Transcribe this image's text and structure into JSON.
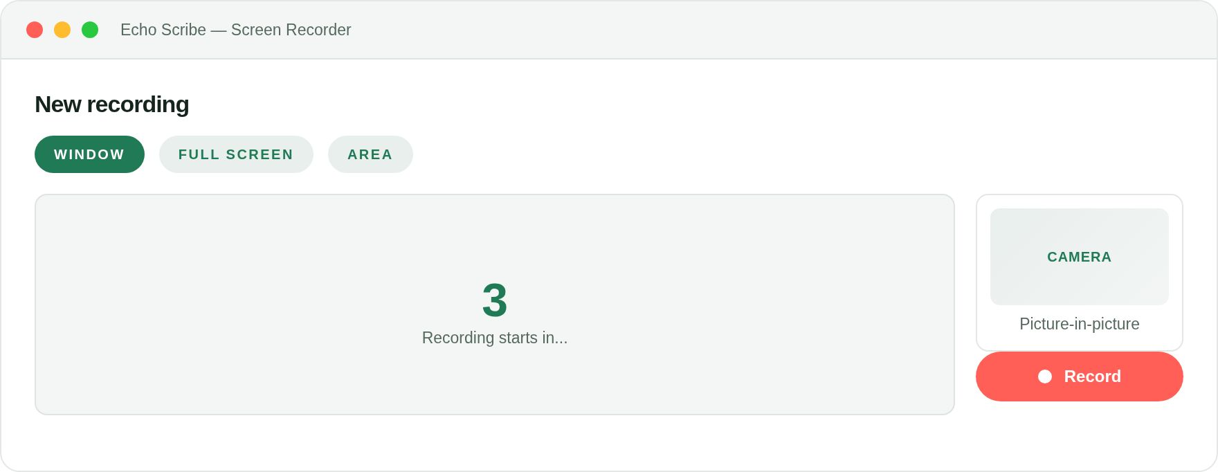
{
  "window": {
    "title": "Echo Scribe — Screen Recorder"
  },
  "heading": "New recording",
  "tabs": [
    {
      "label": "WINDOW",
      "selected": true
    },
    {
      "label": "FULL SCREEN",
      "selected": false
    },
    {
      "label": "AREA",
      "selected": false
    }
  ],
  "preview": {
    "countdown": "3",
    "caption": "Recording starts in..."
  },
  "camera": {
    "label": "CAMERA",
    "caption": "Picture-in-picture"
  },
  "record_button": {
    "label": "Record"
  }
}
